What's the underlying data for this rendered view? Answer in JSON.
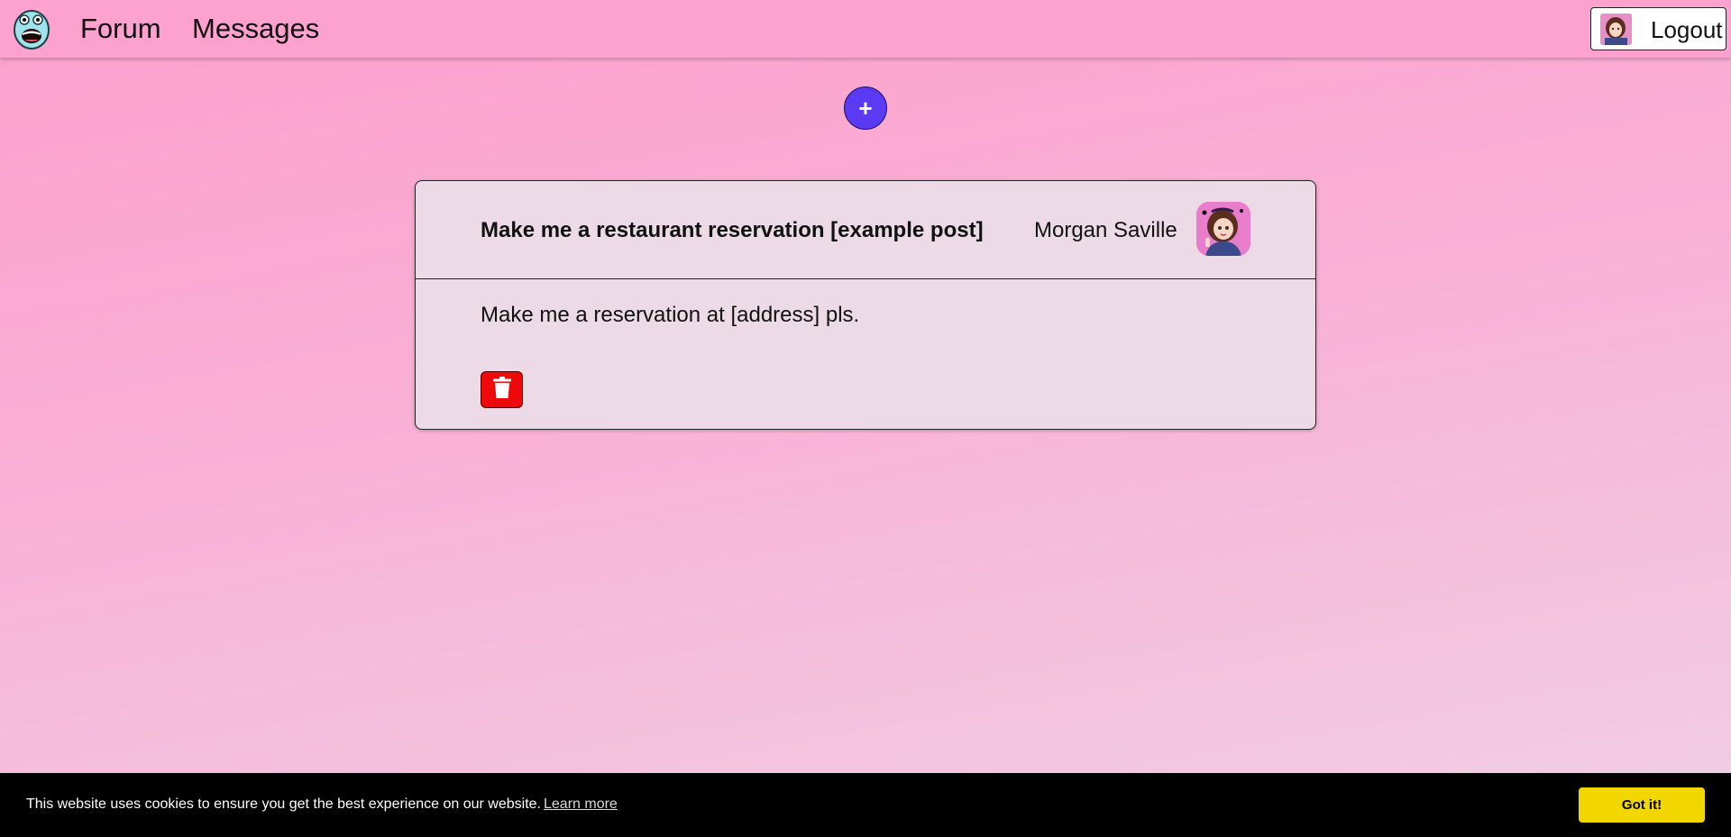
{
  "nav": {
    "logo_icon": "screaming-face-logo-icon",
    "forum_label": "Forum",
    "messages_label": "Messages",
    "logout_label": "Logout",
    "logout_avatar_icon": "user-avatar-icon"
  },
  "actions": {
    "add_label": "+",
    "add_icon": "plus-icon"
  },
  "post": {
    "title": "Make me a restaurant reservation [example post]",
    "author": "Morgan Saville",
    "author_avatar_icon": "user-avatar-icon",
    "body": "Make me a reservation at [address] pls.",
    "delete_icon": "trash-icon"
  },
  "cookie_banner": {
    "message": "This website uses cookies to ensure you get the best experience on our website.",
    "learn_more_label": "Learn more",
    "accept_label": "Got it!"
  },
  "colors": {
    "background": "#fda1cf",
    "card": "#ecdbe7",
    "add_button": "#5a3af2",
    "delete_button": "#ee0a0a",
    "cookie_bar": "#000000",
    "cookie_button": "#f1d600"
  }
}
